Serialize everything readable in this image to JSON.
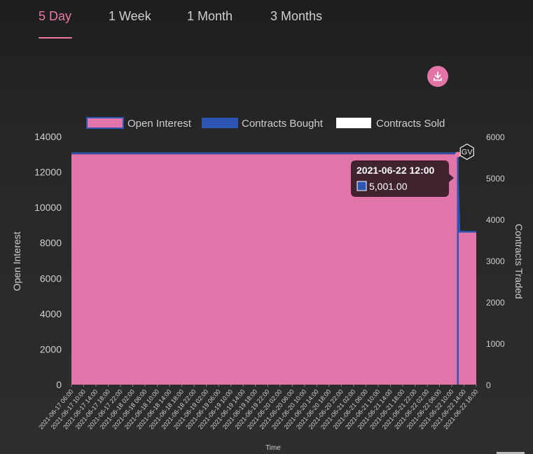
{
  "tabs": [
    {
      "label": "5 Day",
      "active": true
    },
    {
      "label": "1 Week",
      "active": false
    },
    {
      "label": "1 Month",
      "active": false
    },
    {
      "label": "3 Months",
      "active": false
    }
  ],
  "download_icon": "download-icon",
  "colors": {
    "accent": "#e879a8",
    "open_interest": "#e174a9",
    "contracts_bought": "#2d56b3",
    "contracts_sold": "#ffffff",
    "tooltip_bg": "#3a1f2a"
  },
  "chart_data": {
    "type": "area",
    "legend": [
      "Open Interest",
      "Contracts Bought",
      "Contracts Sold"
    ],
    "legend_position": "top",
    "xlabel": "Time",
    "ylabel_left": "Open Interest",
    "ylabel_right": "Contracts Traded",
    "ylim_left": [
      0,
      14000
    ],
    "ylim_right": [
      0,
      6000
    ],
    "yticks_left": [
      "0",
      "2000",
      "4000",
      "6000",
      "8000",
      "10000",
      "12000",
      "14000"
    ],
    "yticks_right": [
      "0",
      "1000",
      "2000",
      "3000",
      "4000",
      "5000",
      "6000"
    ],
    "x_labels": [
      "2021-06-17 06:00",
      "2021-06-17 10:00",
      "2021-06-17 14:00",
      "2021-06-17 18:00",
      "2021-06-17 22:00",
      "2021-06-18 02:00",
      "2021-06-18 06:00",
      "2021-06-18 10:00",
      "2021-06-18 14:00",
      "2021-06-18 18:00",
      "2021-06-18 22:00",
      "2021-06-19 02:00",
      "2021-06-19 06:00",
      "2021-06-19 10:00",
      "2021-06-19 14:00",
      "2021-06-19 18:00",
      "2021-06-19 22:00",
      "2021-06-20 02:00",
      "2021-06-20 06:00",
      "2021-06-20 10:00",
      "2021-06-20 14:00",
      "2021-06-20 18:00",
      "2021-06-20 22:00",
      "2021-06-21 02:00",
      "2021-06-21 06:00",
      "2021-06-21 10:00",
      "2021-06-21 14:00",
      "2021-06-21 18:00",
      "2021-06-21 22:00",
      "2021-06-22 02:00",
      "2021-06-22 06:00",
      "2021-06-22 10:00",
      "2021-06-22 14:00",
      "2021-06-22 18:00"
    ],
    "series": [
      {
        "name": "Open Interest",
        "axis": "left",
        "points": [
          [
            "2021-06-17 06:00",
            13000
          ],
          [
            "2021-06-22 12:00",
            13000
          ],
          [
            "2021-06-22 12:00",
            11700
          ],
          [
            "2021-06-22 12:30",
            8600
          ],
          [
            "2021-06-22 18:00",
            8600
          ]
        ]
      },
      {
        "name": "Contracts Bought",
        "axis": "right",
        "points": [
          [
            "2021-06-17 06:00",
            5600
          ],
          [
            "2021-06-22 12:00",
            5600
          ],
          [
            "2021-06-22 12:00",
            5001
          ],
          [
            "2021-06-22 12:30",
            3700
          ],
          [
            "2021-06-22 18:00",
            3700
          ]
        ]
      },
      {
        "name": "Contracts Sold",
        "axis": "right",
        "points": []
      }
    ],
    "tooltip": {
      "title": "2021-06-22 12:00",
      "value": "5,001.00"
    },
    "marker_label": "GV"
  }
}
